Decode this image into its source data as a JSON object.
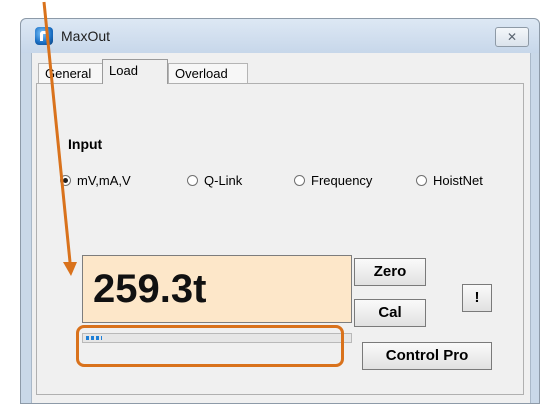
{
  "window": {
    "title": "MaxOut",
    "close_label": "✕"
  },
  "tabs": [
    {
      "label": "General"
    },
    {
      "label": "Load"
    },
    {
      "label": "Overload"
    }
  ],
  "input": {
    "section_label": "Input",
    "options": [
      {
        "label": "mV,mA,V",
        "checked": true
      },
      {
        "label": "Q-Link",
        "checked": false
      },
      {
        "label": "Frequency",
        "checked": false
      },
      {
        "label": "HoistNet",
        "checked": false
      }
    ]
  },
  "readout": {
    "value": "259.3t"
  },
  "progress": {
    "level": 0.06
  },
  "buttons": {
    "zero": "Zero",
    "cal": "Cal",
    "alert": "!",
    "control_pro": "Control Pro"
  },
  "colors": {
    "annotation": "#d9721c",
    "readout_bg": "#fde7c9",
    "progress_fill": "#1e7fd6"
  }
}
